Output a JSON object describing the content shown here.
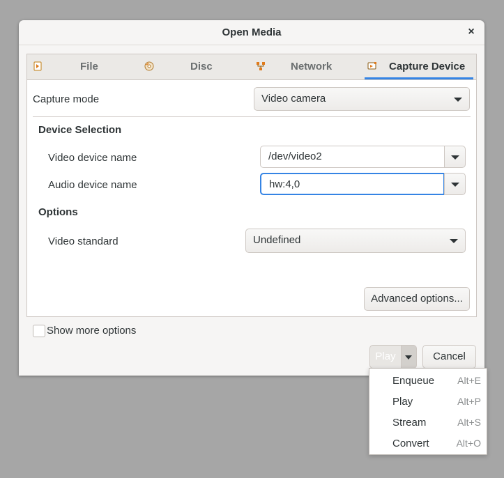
{
  "window": {
    "title": "Open Media",
    "close_glyph": "×"
  },
  "tabs": [
    {
      "label": "File",
      "icon": "file-icon",
      "active": false
    },
    {
      "label": "Disc",
      "icon": "disc-icon",
      "active": false
    },
    {
      "label": "Network",
      "icon": "network-icon",
      "active": false
    },
    {
      "label": "Capture Device",
      "icon": "capture-device-icon",
      "active": true
    }
  ],
  "capture": {
    "mode_label": "Capture mode",
    "mode_value": "Video camera",
    "device_selection_title": "Device Selection",
    "video_device_label": "Video device name",
    "video_device_value": "/dev/video2",
    "audio_device_label": "Audio device name",
    "audio_device_value": "hw:4,0",
    "options_title": "Options",
    "video_standard_label": "Video standard",
    "video_standard_value": "Undefined",
    "advanced_button": "Advanced options..."
  },
  "footer": {
    "show_more_label": "Show more options",
    "show_more_checked": false,
    "play_label": "Play",
    "cancel_label": "Cancel"
  },
  "play_menu": {
    "items": [
      {
        "label": "Enqueue",
        "accel": "Alt+E"
      },
      {
        "label": "Play",
        "accel": "Alt+P"
      },
      {
        "label": "Stream",
        "accel": "Alt+S"
      },
      {
        "label": "Convert",
        "accel": "Alt+O"
      }
    ]
  },
  "colors": {
    "accent": "#3584e4",
    "background": "#f6f5f4",
    "desktop": "#a6a6a6"
  }
}
